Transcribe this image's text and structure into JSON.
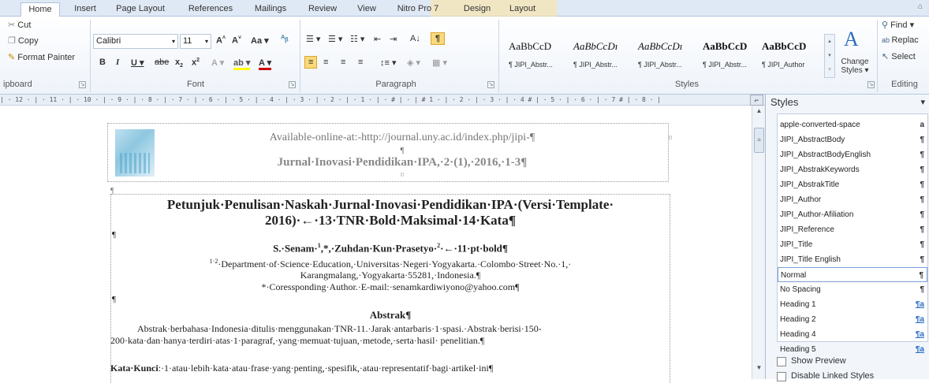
{
  "tabs": [
    "Home",
    "Insert",
    "Page Layout",
    "References",
    "Mailings",
    "Review",
    "View",
    "Nitro Pro 7",
    "Design",
    "Layout"
  ],
  "clipboard": {
    "cut": "Cut",
    "copy": "Copy",
    "format_painter": "Format Painter",
    "label": "ipboard"
  },
  "font": {
    "name": "Calibri",
    "size": "11",
    "label": "Font"
  },
  "paragraph": {
    "label": "Paragraph"
  },
  "styles": {
    "label": "Styles",
    "gallery": [
      {
        "sample": "AaBbCcD",
        "caption": "¶ JIPI_Abstr..."
      },
      {
        "sample": "AaBbCcDı",
        "caption": "¶ JIPI_Abstr..."
      },
      {
        "sample": "AaBbCcDı",
        "caption": "¶ JIPI_Abstr..."
      },
      {
        "sample": "AaBbCcD",
        "caption": "¶ JIPI_Abstr..."
      },
      {
        "sample": "AaBbCcD",
        "caption": "¶ JIPI_Author"
      }
    ],
    "change_styles": "Change Styles"
  },
  "editing": {
    "find": "Find",
    "replace": "Replac",
    "select": "Select",
    "label": "Editing"
  },
  "ruler_text": "| · 12 · | · 11 · | · 10 · | · 9 · | · 8 · | · 7 · | · 6 · | · 5 · | · 4 · | · 3 · | · 2 · | · 1 · | · # |   · |  # 1 · | · 2 · | · 3 · | · 4 # | · 5 · | · 6 · | · 7 # | · 8 · |",
  "doc": {
    "header_line1": "Available-online-at:-http://journal.uny.ac.id/index.php/jipi-¶",
    "header_line2": "¶",
    "header_line3": "Jurnal·Inovasi·Pendidikan·IPA,·2·(1),·2016,·1-3¶",
    "header_cellmark": "¤",
    "header_rowmark": "¤",
    "pilcrow": "¶",
    "title": "Petunjuk·Penulisan·Naskah·Jurnal·Inovasi·Pendidikan·IPA·(Versi·Template· 2016)·←·13·TNR·Bold·Maksimal·14·Kata¶",
    "authors_pre": "S.·Senam·",
    "authors_sup1": "1",
    "authors_mid": ",*,·Zuhdan·Kun·Prasetyo·",
    "authors_sup2": "2",
    "authors_post": "·←·11·pt·bold¶",
    "affil_sup": "1·2",
    "affil_line1": "·Department·of·Science·Education,·Universitas·Negeri·Yogyakarta.·Colombo·Street·No.·1,·",
    "affil_line2": "Karangmalang,·Yogyakarta·55281,·Indonesia.¶",
    "email": "*·Coressponding·Author.·E-mail:·senamkardiwiyono@yahoo.com¶",
    "abstract_heading": "Abstrak¶",
    "abstract_body": "Abstrak·berbahasa·Indonesia·ditulis·menggunakan·TNR-11.·Jarak·antarbaris·1·spasi.·Abstrak·berisi·150-200·kata·dan·hanya·terdiri·atas·1·paragraf,·yang·memuat·tujuan,·metode,·serta·hasil· penelitian.¶",
    "keywords_label": "Kata·Kunci",
    "keywords_text": ":·1·atau·lebih·kata·atau·frase·yang·penting,·spesifik,·atau·representatif·bagi·artikel·ini¶"
  },
  "panel": {
    "title": "Styles",
    "items": [
      {
        "name": "apple-converted-space",
        "mark": "a"
      },
      {
        "name": "JIPI_AbstractBody",
        "mark": "¶"
      },
      {
        "name": "JIPI_AbstractBodyEnglish",
        "mark": "¶"
      },
      {
        "name": "JIPI_AbstrakKeywords",
        "mark": "¶"
      },
      {
        "name": "JIPI_AbstrakTitle",
        "mark": "¶"
      },
      {
        "name": "JIPI_Author",
        "mark": "¶"
      },
      {
        "name": "JIPI_Author-Afiliation",
        "mark": "¶"
      },
      {
        "name": "JIPI_Reference",
        "mark": "¶"
      },
      {
        "name": "JIPI_Title",
        "mark": "¶"
      },
      {
        "name": "JIPI_Title English",
        "mark": "¶"
      },
      {
        "name": "Normal",
        "mark": "¶"
      },
      {
        "name": "No Spacing",
        "mark": "¶"
      },
      {
        "name": "Heading 1",
        "mark": "¶a"
      },
      {
        "name": "Heading 2",
        "mark": "¶a"
      },
      {
        "name": "Heading 4",
        "mark": "¶a"
      },
      {
        "name": "Heading 5",
        "mark": "¶a"
      }
    ],
    "selected": "Normal",
    "show_preview": "Show Preview",
    "disable_linked": "Disable Linked Styles"
  }
}
